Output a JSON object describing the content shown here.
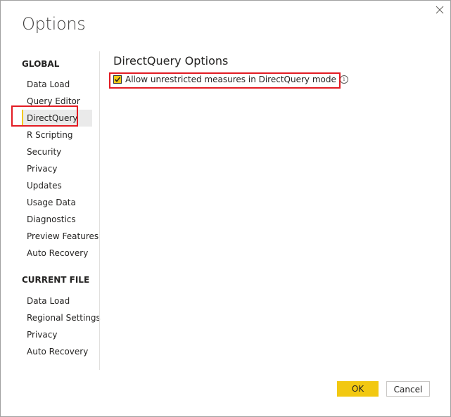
{
  "dialog": {
    "title": "Options"
  },
  "sidebar": {
    "global_header": "GLOBAL",
    "global_items": [
      {
        "label": "Data Load"
      },
      {
        "label": "Query Editor"
      },
      {
        "label": "DirectQuery"
      },
      {
        "label": "R Scripting"
      },
      {
        "label": "Security"
      },
      {
        "label": "Privacy"
      },
      {
        "label": "Updates"
      },
      {
        "label": "Usage Data"
      },
      {
        "label": "Diagnostics"
      },
      {
        "label": "Preview Features"
      },
      {
        "label": "Auto Recovery"
      }
    ],
    "selected_item": "DirectQuery",
    "current_file_header": "CURRENT FILE",
    "current_file_items": [
      {
        "label": "Data Load"
      },
      {
        "label": "Regional Settings"
      },
      {
        "label": "Privacy"
      },
      {
        "label": "Auto Recovery"
      }
    ]
  },
  "content": {
    "title": "DirectQuery Options",
    "option_label": "Allow unrestricted measures in DirectQuery mode",
    "option_checked": true,
    "info_icon": "info-icon"
  },
  "footer": {
    "ok_label": "OK",
    "cancel_label": "Cancel"
  },
  "colors": {
    "accent": "#f2c811",
    "highlight": "#e31b23",
    "selected_bg": "#eaeaea"
  }
}
